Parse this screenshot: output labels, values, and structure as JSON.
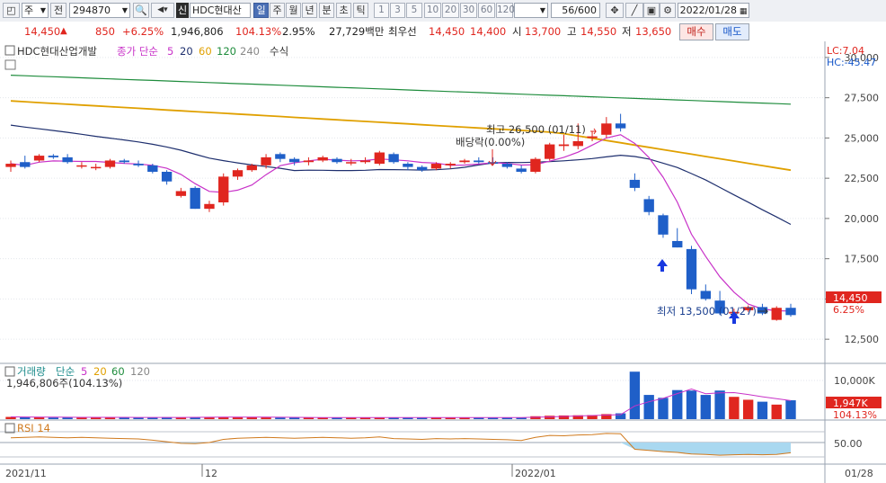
{
  "toolbar": {
    "period_type": "주",
    "prev_label": "전",
    "stock_code": "294870",
    "new_label": "신",
    "stock_name": "HDC현대산업",
    "period_buttons": [
      "일",
      "주",
      "월",
      "년",
      "분",
      "초",
      "틱"
    ],
    "interval_buttons": [
      "1",
      "3",
      "5",
      "10",
      "20",
      "30",
      "60",
      "120"
    ],
    "count": "56/600",
    "date": "2022/01/28"
  },
  "quote": {
    "price": "14,450",
    "change": "850",
    "change_pct": "+6.25%",
    "volume": "1,946,806",
    "volume_ratio": "104.13%",
    "turnover": "2.95%",
    "amount": "27,729백만",
    "best_ask_label": "최우선",
    "best_ask": "14,450",
    "best_bid": "14,400",
    "open_label": "시",
    "open": "13,700",
    "high_label": "고",
    "high": "14,550",
    "low_label": "저",
    "low": "13,650",
    "buy_label": "매수",
    "sell_label": "매도"
  },
  "legend": {
    "name": "HDC현대산업개발",
    "ma_title": "종가 단순",
    "ma_periods": [
      "5",
      "20",
      "60",
      "120",
      "240"
    ],
    "formula": "수식",
    "lc": "LC:7.04",
    "hc": "HC:-45.47"
  },
  "annotations": {
    "high": "최고 26,500 (01/11)",
    "low": "최저 13,500 (01/27)",
    "dividend": "배당락(0.00%)",
    "last_price": "14,450",
    "last_pct": "6.25%"
  },
  "volume_panel": {
    "title": "거래량",
    "ma_title": "단순",
    "ma_periods": [
      "5",
      "20",
      "60",
      "120"
    ],
    "current": "1,946,806주(104.13%)",
    "tag_value": "1,947K",
    "tag_pct": "104.13%",
    "axis_label": "10,000K"
  },
  "rsi_panel": {
    "title": "RSI 14",
    "axis_label": "50.00"
  },
  "x_axis": {
    "labels": [
      "2021/11",
      "12",
      "2022/01"
    ],
    "right_label": "01/28"
  },
  "colors": {
    "up": "#e0261f",
    "down": "#1f5fc8",
    "ma5": "#c832c8",
    "ma20": "#1e2f6e",
    "ma60": "#e0a000",
    "ma120": "#1e8c3c",
    "rsi": "#d07a1e"
  },
  "chart_data": {
    "type": "candlestick",
    "y_ticks": [
      12500,
      15000,
      17500,
      20000,
      22500,
      25000,
      27500,
      30000
    ],
    "ylim": [
      11000,
      31000
    ],
    "candles": [
      [
        23200,
        23600,
        22900,
        23400
      ],
      [
        23500,
        23900,
        23100,
        23200
      ],
      [
        23600,
        24000,
        23500,
        23900
      ],
      [
        23900,
        24000,
        23700,
        23800
      ],
      [
        23800,
        24000,
        23400,
        23500
      ],
      [
        23300,
        23500,
        23100,
        23300
      ],
      [
        23200,
        23400,
        23000,
        23200
      ],
      [
        23200,
        23700,
        23100,
        23600
      ],
      [
        23600,
        23700,
        23400,
        23500
      ],
      [
        23400,
        23600,
        23200,
        23300
      ],
      [
        23300,
        23400,
        22800,
        22900
      ],
      [
        22900,
        23000,
        22100,
        22300
      ],
      [
        21400,
        21900,
        21300,
        21700
      ],
      [
        21900,
        22000,
        20600,
        20600
      ],
      [
        20600,
        21100,
        20400,
        20900
      ],
      [
        21000,
        22800,
        20800,
        22600
      ],
      [
        22600,
        23100,
        22400,
        23000
      ],
      [
        23000,
        23400,
        22900,
        23300
      ],
      [
        23300,
        24000,
        23100,
        23800
      ],
      [
        24000,
        24100,
        23500,
        23700
      ],
      [
        23700,
        23800,
        23300,
        23500
      ],
      [
        23500,
        23800,
        23300,
        23600
      ],
      [
        23600,
        23900,
        23500,
        23800
      ],
      [
        23700,
        23800,
        23400,
        23500
      ],
      [
        23500,
        23700,
        23300,
        23500
      ],
      [
        23500,
        23800,
        23400,
        23600
      ],
      [
        23400,
        24200,
        23300,
        24100
      ],
      [
        24000,
        24100,
        23400,
        23500
      ],
      [
        23400,
        23500,
        23000,
        23200
      ],
      [
        23200,
        23300,
        22900,
        23000
      ],
      [
        23100,
        23500,
        23000,
        23400
      ],
      [
        23300,
        23500,
        23100,
        23400
      ],
      [
        23500,
        23700,
        23400,
        23600
      ],
      [
        23600,
        23800,
        23400,
        23500
      ],
      [
        23500,
        23800,
        23300,
        23400
      ],
      [
        23400,
        23500,
        23100,
        23200
      ],
      [
        23100,
        23300,
        22800,
        22900
      ],
      [
        22900,
        23800,
        22800,
        23700
      ],
      [
        23700,
        24700,
        23600,
        24600
      ],
      [
        24500,
        25200,
        24200,
        24600
      ],
      [
        24500,
        25900,
        24300,
        24800
      ],
      [
        25000,
        25400,
        24800,
        25100
      ],
      [
        25200,
        26300,
        25000,
        25900
      ],
      [
        25900,
        26500,
        25400,
        25600
      ],
      [
        22400,
        22800,
        21700,
        21900
      ],
      [
        21200,
        21400,
        20200,
        20400
      ],
      [
        20200,
        20300,
        18800,
        19000
      ],
      [
        18600,
        19400,
        18200,
        18200
      ],
      [
        18100,
        18300,
        15300,
        15600
      ],
      [
        15500,
        15900,
        14900,
        15000
      ],
      [
        14900,
        15500,
        14000,
        14100
      ],
      [
        14100,
        14400,
        14000,
        14200
      ],
      [
        14300,
        14600,
        14200,
        14500
      ],
      [
        14500,
        14700,
        14000,
        14100
      ],
      [
        13700,
        14550,
        13650,
        14450
      ],
      [
        14450,
        14700,
        13900,
        14000
      ]
    ],
    "volume": [
      230,
      210,
      190,
      170,
      180,
      200,
      190,
      180,
      170,
      160,
      180,
      200,
      190,
      210,
      200,
      220,
      210,
      190,
      180,
      170,
      160,
      170,
      160,
      170,
      180,
      160,
      150,
      170,
      160,
      150,
      160,
      150,
      170,
      160,
      160,
      170,
      180,
      300,
      350,
      380,
      400,
      420,
      520,
      600,
      4900,
      2500,
      2200,
      3000,
      2950,
      2500,
      2950,
      2300,
      2000,
      1800,
      1500,
      1947
    ],
    "rsi": [
      62,
      63,
      64,
      63,
      62,
      63,
      62,
      61,
      60,
      59,
      56,
      52,
      48,
      47,
      50,
      58,
      61,
      62,
      63,
      62,
      61,
      62,
      63,
      62,
      61,
      62,
      64,
      60,
      59,
      58,
      60,
      59,
      60,
      59,
      58,
      57,
      55,
      63,
      68,
      67,
      69,
      70,
      73,
      72,
      33,
      30,
      27,
      25,
      21,
      20,
      18,
      19,
      20,
      19,
      20,
      24
    ]
  }
}
